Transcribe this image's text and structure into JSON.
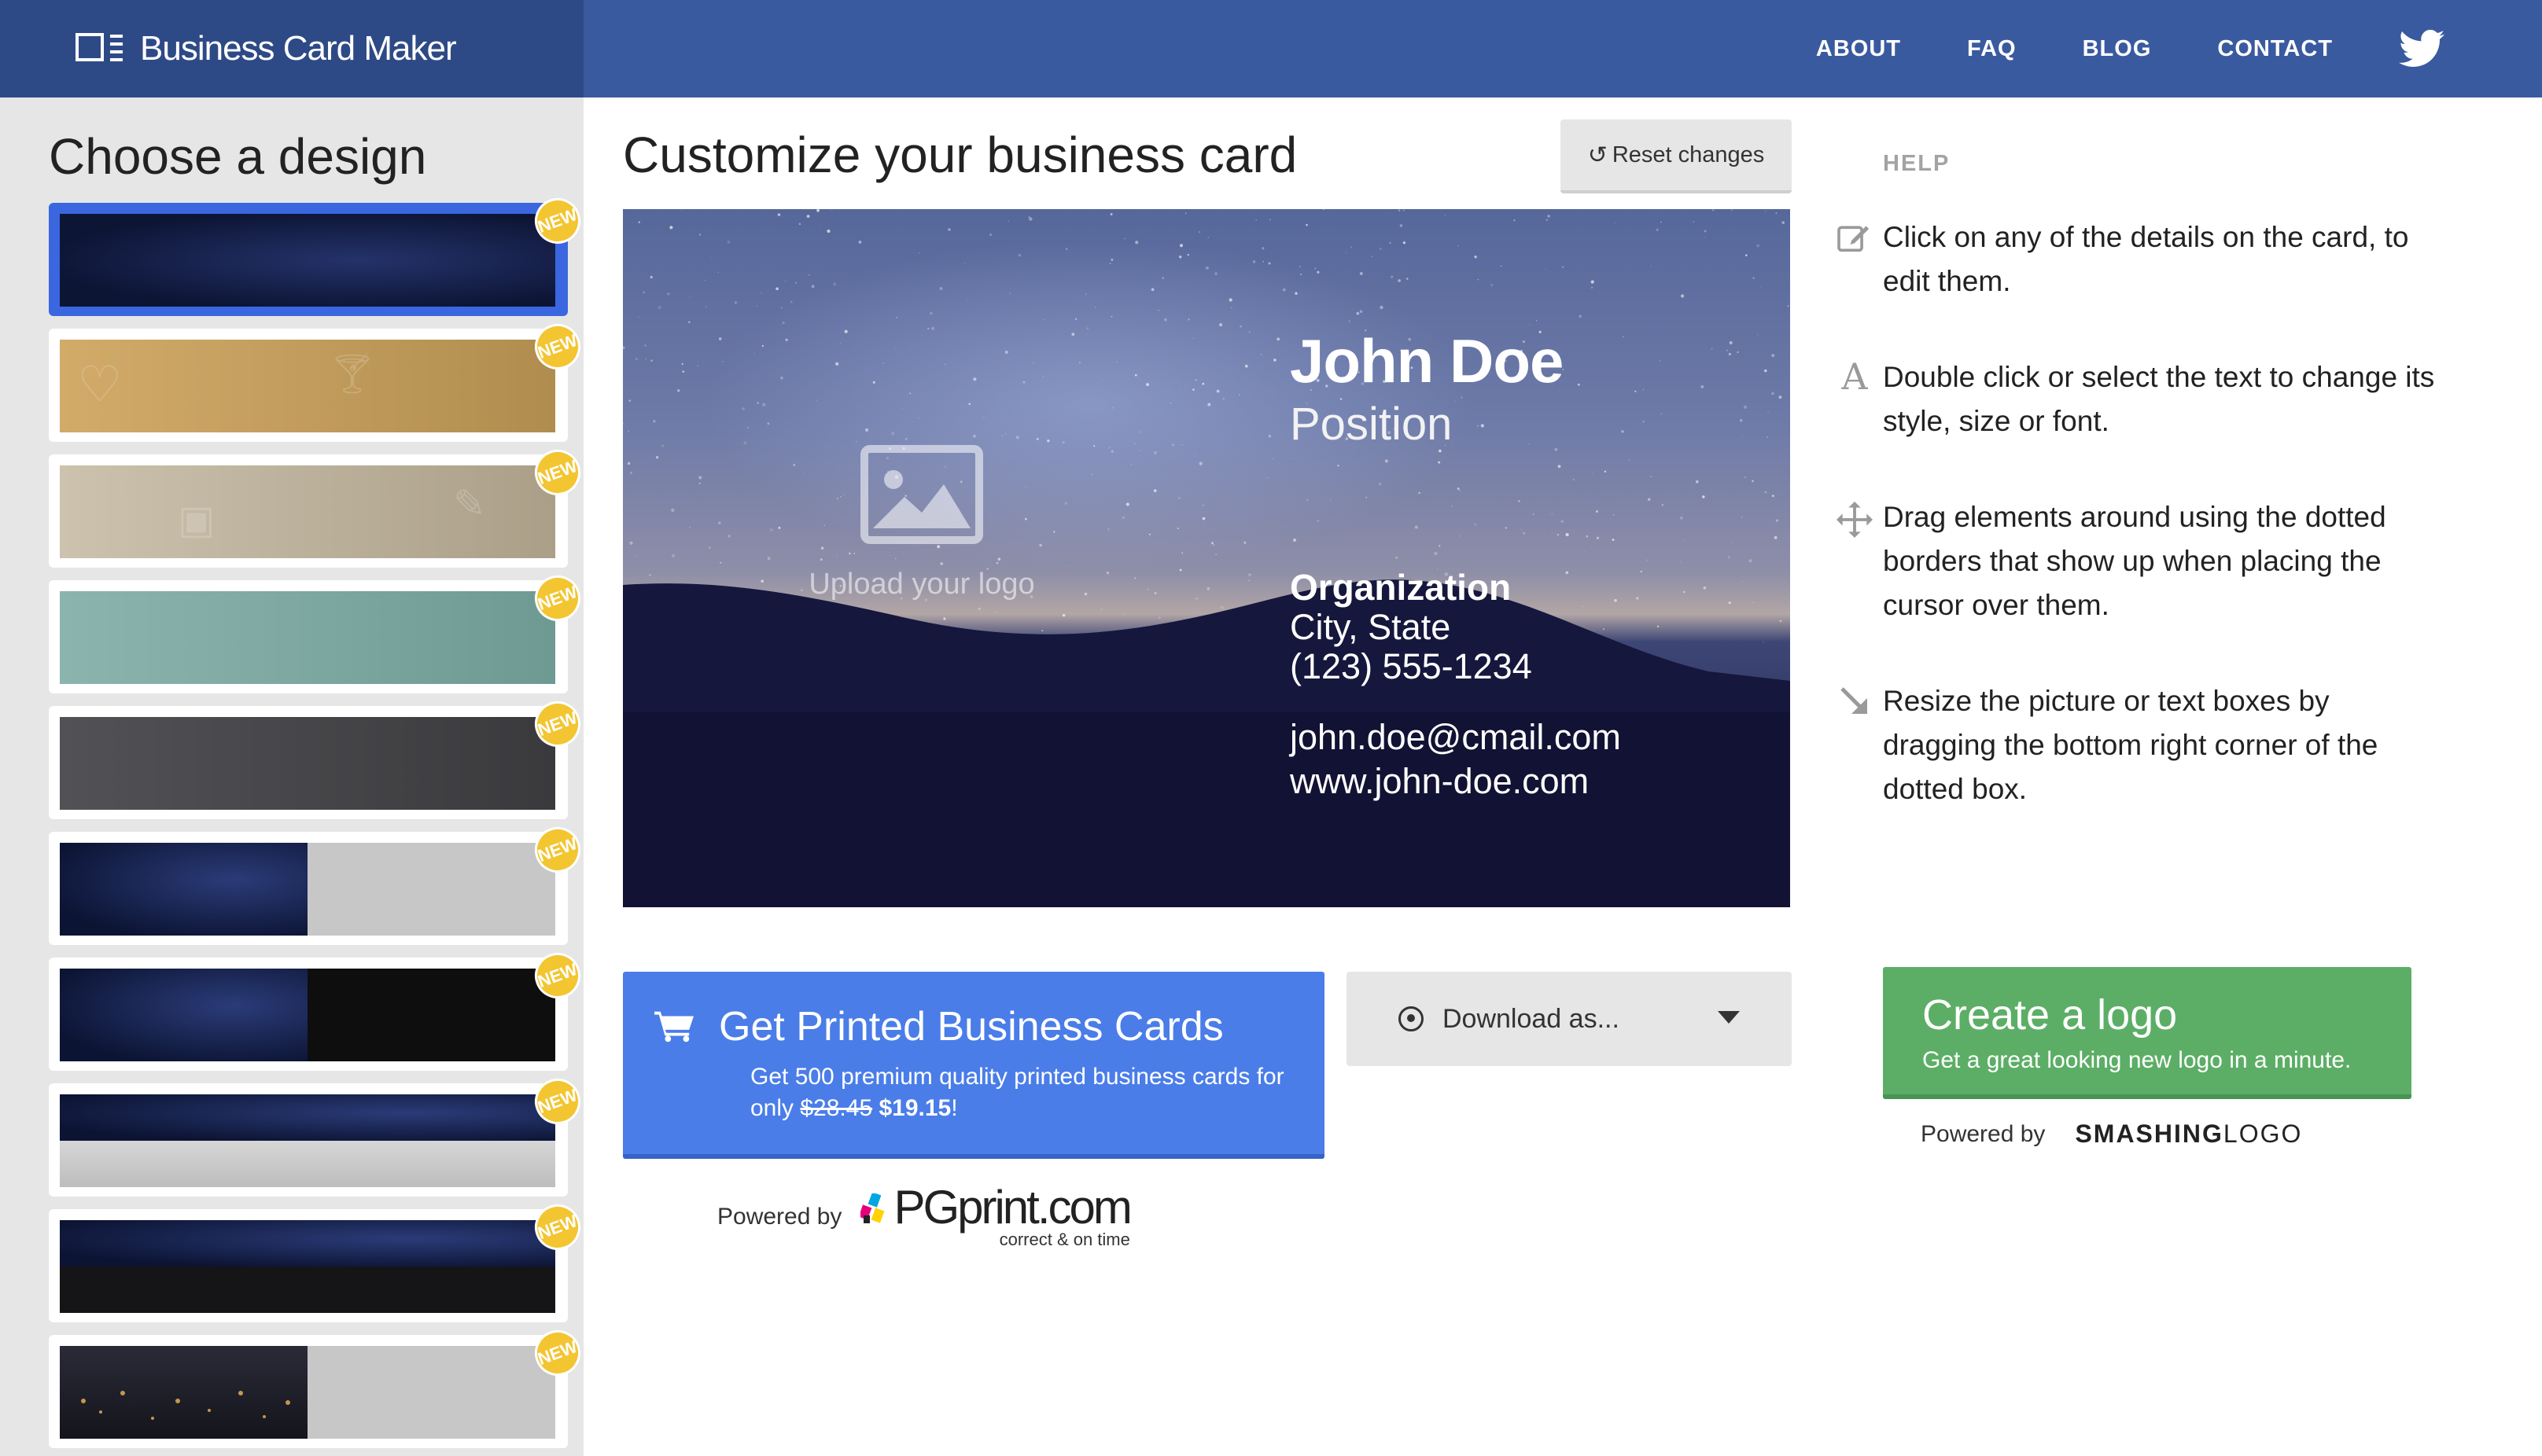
{
  "brand": {
    "title": "Business Card Maker"
  },
  "nav": {
    "links": [
      "ABOUT",
      "FAQ",
      "BLOG",
      "CONTACT"
    ],
    "social_icon": "twitter-icon"
  },
  "sidebar": {
    "title": "Choose a design",
    "badge_label": "NEW",
    "designs": [
      {
        "style": "starry-night",
        "selected": true,
        "badge": "NEW"
      },
      {
        "style": "gold-icons",
        "selected": false,
        "badge": "NEW"
      },
      {
        "style": "beige-icons",
        "selected": false,
        "badge": "NEW"
      },
      {
        "style": "teal",
        "selected": false,
        "badge": "NEW"
      },
      {
        "style": "charcoal",
        "selected": false,
        "badge": "NEW"
      },
      {
        "style": "galaxy-grey-split",
        "selected": false,
        "badge": "NEW"
      },
      {
        "style": "galaxy-black-split",
        "selected": false,
        "badge": "NEW"
      },
      {
        "style": "galaxy-grey-band",
        "selected": false,
        "badge": "NEW"
      },
      {
        "style": "galaxy-black-band",
        "selected": false,
        "badge": "NEW"
      },
      {
        "style": "city-grey-split",
        "selected": false,
        "badge": "NEW"
      }
    ]
  },
  "main": {
    "title": "Customize your business card",
    "reset_label": "Reset changes",
    "card": {
      "logo_caption": "Upload your logo",
      "name": "John Doe",
      "position": "Position",
      "organization": "Organization",
      "city_state": "City, State",
      "phone": "(123) 555-1234",
      "email": "john.doe@cmail.com",
      "website": "www.john-doe.com"
    },
    "print": {
      "title": "Get Printed Business Cards",
      "sub_prefix": "Get 500 premium quality printed business cards for only ",
      "old_price": "$28.45",
      "new_price": "$19.15",
      "suffix": "!"
    },
    "powered_by_label": "Powered by",
    "pg": {
      "name": "PGprint.com",
      "tagline": "correct & on time"
    },
    "download_label": "Download as..."
  },
  "help": {
    "heading": "HELP",
    "items": [
      {
        "icon": "edit-icon",
        "text": "Click on any of the details on the card, to edit them."
      },
      {
        "icon": "font-icon",
        "text": "Double click or select the text to change its style, size or font."
      },
      {
        "icon": "move-icon",
        "text": "Drag elements around using the dotted borders that show up when placing the cursor over them."
      },
      {
        "icon": "resize-arrow-icon",
        "text": "Resize the picture or text boxes by dragging the bottom right corner of the dotted box."
      }
    ],
    "logo_cta": {
      "title": "Create a logo",
      "subtitle": "Get a great looking new logo in a minute."
    },
    "powered_by_label": "Powered by",
    "smashing_bold": "SMASHING",
    "smashing_light": "LOGO"
  },
  "colors": {
    "nav": "#3a5aa0",
    "brand": "#2e4a86",
    "print_button": "#4a7de8",
    "logo_button": "#5cae66",
    "badge": "#f3c531",
    "selected_border": "#3a66e0"
  }
}
